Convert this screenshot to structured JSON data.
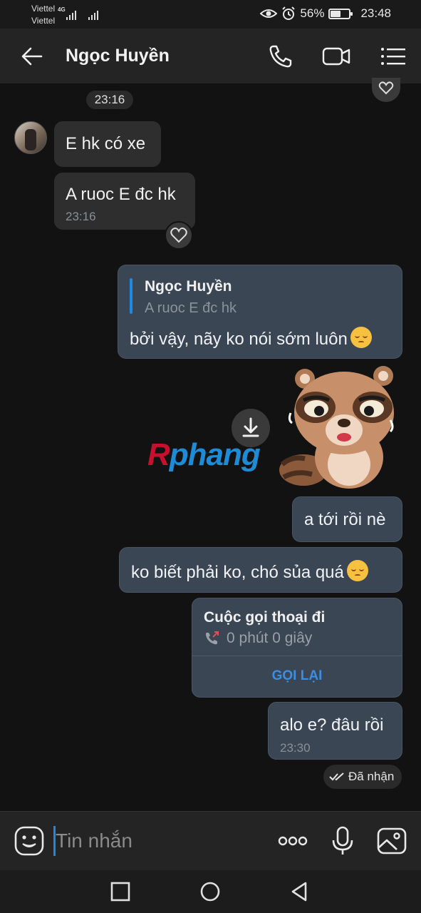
{
  "status_bar": {
    "carrier_1": "Viettel",
    "carrier_2": "Viettel",
    "network": "4G",
    "battery_percent": "56%",
    "battery_level": 0.56,
    "time": "23:48"
  },
  "header": {
    "contact_name": "Ngọc Huyền"
  },
  "messages": {
    "time_divider": "23:16",
    "incoming_1": {
      "text": "E hk có xe"
    },
    "incoming_2": {
      "text": "A ruoc E đc hk",
      "time": "23:16"
    },
    "reply": {
      "quote_name": "Ngọc Huyền",
      "quote_text": "A ruoc E đc hk",
      "text": "bởi vậy, nãy ko nói sớm luôn"
    },
    "watermark": {
      "first": "R",
      "rest": "phang"
    },
    "outgoing_1": {
      "text": "a tới rồi nè"
    },
    "outgoing_2": {
      "text": "ko biết phải ko, chó sủa quá"
    },
    "call_card": {
      "title": "Cuộc gọi thoại đi",
      "duration": "0 phút 0 giây",
      "action": "GỌI LẠI"
    },
    "outgoing_3": {
      "text": "alo e? đâu rồi",
      "time": "23:30"
    },
    "delivery_status": "Đã nhận"
  },
  "input_bar": {
    "placeholder": "Tin nhắn"
  },
  "colors": {
    "accent": "#1e88e5",
    "outgoing_bubble": "#3b4654",
    "incoming_bubble": "#2e2e2e",
    "background": "#121212"
  },
  "icons": [
    "arrow-left-icon",
    "phone-icon",
    "video-call-icon",
    "menu-list-icon",
    "heart-icon",
    "download-icon",
    "outgoing-call-icon",
    "double-check-icon",
    "emoji-icon",
    "more-dots-icon",
    "microphone-icon",
    "image-icon",
    "nav-recents-icon",
    "nav-home-icon",
    "nav-back-icon"
  ]
}
